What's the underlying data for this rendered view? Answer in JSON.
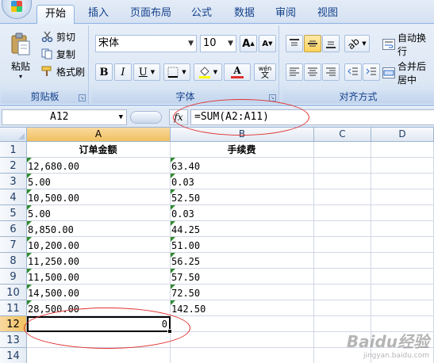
{
  "tabs": [
    "开始",
    "插入",
    "页面布局",
    "公式",
    "数据",
    "审阅",
    "视图"
  ],
  "active_tab": "开始",
  "clipboard": {
    "paste_label": "粘贴",
    "cut_label": "剪切",
    "copy_label": "复制",
    "format_painter_label": "格式刷",
    "group_label": "剪贴板"
  },
  "font": {
    "name": "宋体",
    "size": "10",
    "group_label": "字体",
    "bold": "B",
    "italic": "I",
    "underline": "U",
    "grow": "A",
    "shrink": "A",
    "font_color_glyph": "A",
    "phonetic": "wén"
  },
  "alignment": {
    "wrap_label": "自动换行",
    "merge_label": "合并后居中",
    "group_label": "对齐方式"
  },
  "formula_bar": {
    "name_box": "A12",
    "fx": "fx",
    "formula": "=SUM(A2:A11)"
  },
  "columns": [
    "A",
    "B",
    "C",
    "D"
  ],
  "active_column": "A",
  "rows": [
    "1",
    "2",
    "3",
    "4",
    "5",
    "6",
    "7",
    "8",
    "9",
    "10",
    "11",
    "12",
    "13",
    "14"
  ],
  "active_row": "12",
  "headers": {
    "a": "订单金额",
    "b": "手续费"
  },
  "data": [
    {
      "a": "12,680.00",
      "b": "63.40"
    },
    {
      "a": "5.00",
      "b": "0.03"
    },
    {
      "a": "10,500.00",
      "b": "52.50"
    },
    {
      "a": "5.00",
      "b": "0.03"
    },
    {
      "a": "8,850.00",
      "b": "44.25"
    },
    {
      "a": "10,200.00",
      "b": "51.00"
    },
    {
      "a": "11,250.00",
      "b": "56.25"
    },
    {
      "a": "11,500.00",
      "b": "57.50"
    },
    {
      "a": "14,500.00",
      "b": "72.50"
    },
    {
      "a": "28,500.00",
      "b": "142.50"
    }
  ],
  "sum_result": "0",
  "watermark": {
    "brand": "Baidu经验",
    "url": "jingyan.baidu.com"
  },
  "colors": {
    "annotation": "#e0312f",
    "error_indicator": "#2e8b2e",
    "accent": "#15428b"
  }
}
